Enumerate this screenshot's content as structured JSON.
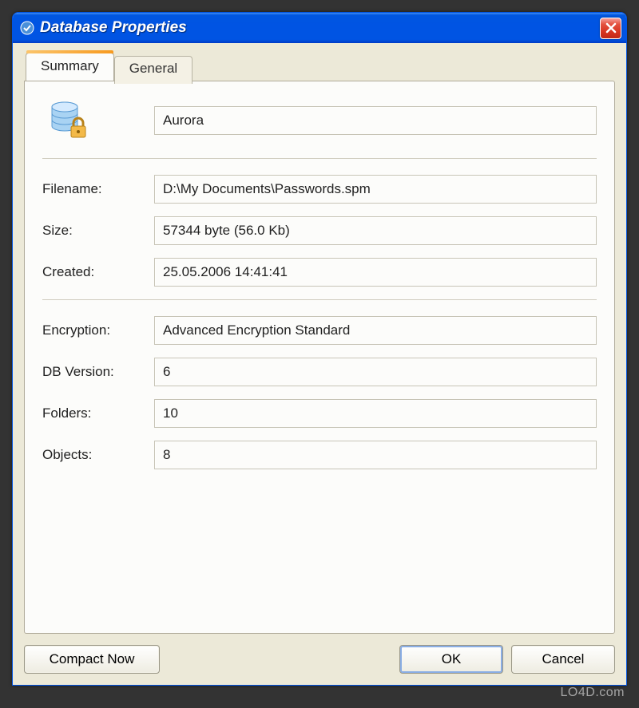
{
  "window": {
    "title": "Database Properties"
  },
  "tabs": {
    "summary": "Summary",
    "general": "General"
  },
  "fields": {
    "name": "Aurora",
    "filename_label": "Filename:",
    "filename": "D:\\My Documents\\Passwords.spm",
    "size_label": "Size:",
    "size": "57344 byte (56.0 Kb)",
    "created_label": "Created:",
    "created": "25.05.2006 14:41:41",
    "encryption_label": "Encryption:",
    "encryption": "Advanced Encryption Standard",
    "dbversion_label": "DB Version:",
    "dbversion": "6",
    "folders_label": "Folders:",
    "folders": "10",
    "objects_label": "Objects:",
    "objects": "8"
  },
  "buttons": {
    "compact": "Compact Now",
    "ok": "OK",
    "cancel": "Cancel"
  },
  "watermark": "LO4D.com"
}
